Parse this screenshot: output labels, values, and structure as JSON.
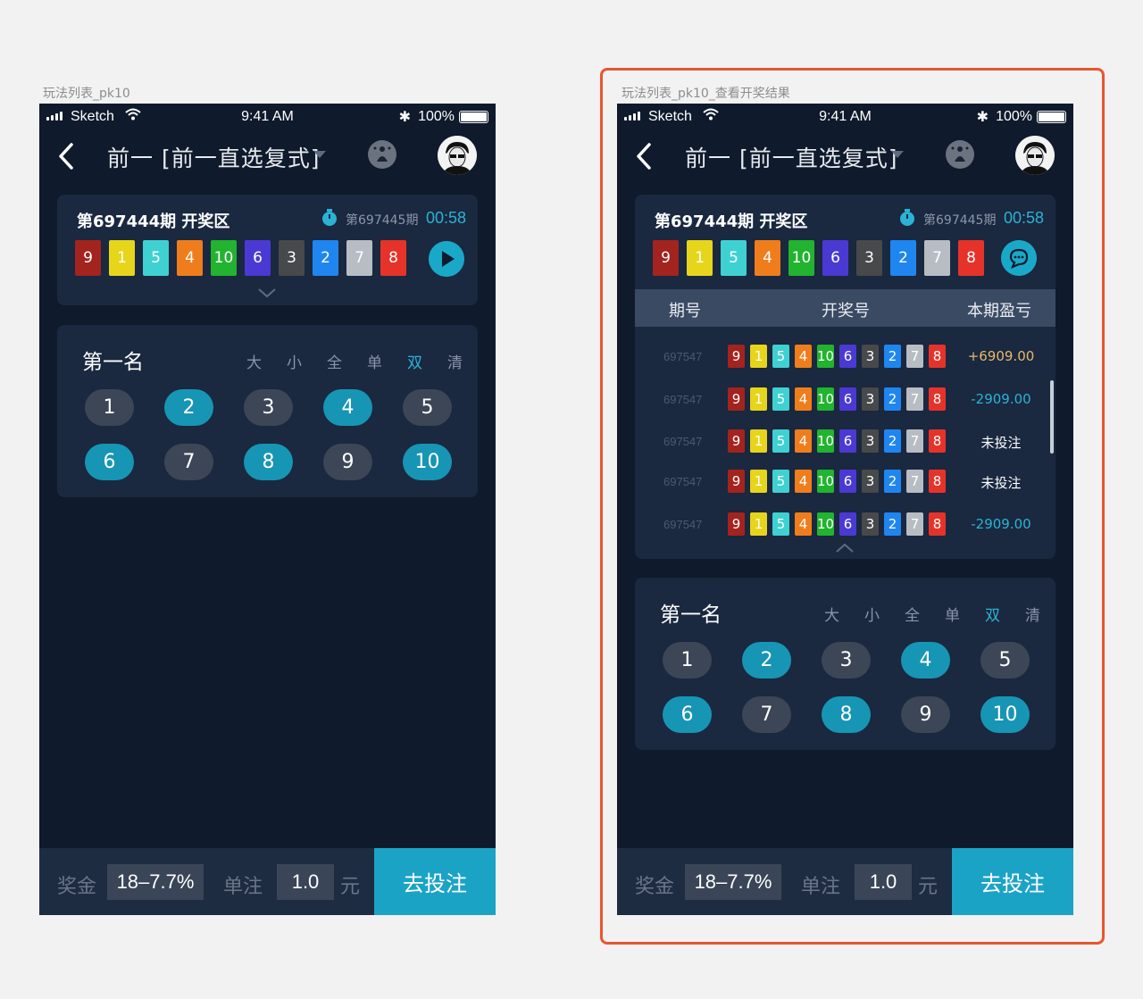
{
  "artboards": {
    "left_label": "玩法列表_pk10",
    "right_label": "玩法列表_pk10_查看开奖结果"
  },
  "status_bar": {
    "carrier": "Sketch",
    "time": "9:41 AM",
    "battery": "100%",
    "wifi_icon": "wifi-icon",
    "bluetooth_icon": "bluetooth-icon"
  },
  "nav": {
    "title": "前一 [前一直选复式]",
    "back_icon": "chevron-left-icon",
    "help_icon": "help-icon",
    "avatar_icon": "avatar"
  },
  "draw": {
    "title": "第697444期 开奖区",
    "next_period": "第697445期",
    "countdown": "00:58",
    "balls": [
      {
        "n": "9",
        "color": "#a3231e"
      },
      {
        "n": "1",
        "color": "#e7d51c"
      },
      {
        "n": "5",
        "color": "#3fd1d1"
      },
      {
        "n": "4",
        "color": "#f07d1c"
      },
      {
        "n": "10",
        "color": "#22b32f"
      },
      {
        "n": "6",
        "color": "#4b39d3"
      },
      {
        "n": "3",
        "color": "#48494b"
      },
      {
        "n": "2",
        "color": "#1f86f0"
      },
      {
        "n": "7",
        "color": "#b8bdc4"
      },
      {
        "n": "8",
        "color": "#e6332a"
      }
    ]
  },
  "history": {
    "headers": [
      "期号",
      "开奖号",
      "本期盈亏"
    ],
    "rows": [
      {
        "period": "697547",
        "result": "+6909.00",
        "color": "#e8b76b"
      },
      {
        "period": "697547",
        "result": "-2909.00",
        "color": "#2bb3d4"
      },
      {
        "period": "697547",
        "result": "未投注",
        "color": "#ffffff"
      },
      {
        "period": "697547",
        "result": "未投注",
        "color": "#ffffff"
      },
      {
        "period": "697547",
        "result": "-2909.00",
        "color": "#2bb3d4"
      }
    ]
  },
  "pick": {
    "title": "第一名",
    "filters": [
      {
        "label": "大",
        "active": false
      },
      {
        "label": "小",
        "active": false
      },
      {
        "label": "全",
        "active": false
      },
      {
        "label": "单",
        "active": false
      },
      {
        "label": "双",
        "active": true
      },
      {
        "label": "清",
        "active": false
      }
    ],
    "numbers": [
      {
        "n": "1",
        "selected": false
      },
      {
        "n": "2",
        "selected": true
      },
      {
        "n": "3",
        "selected": false
      },
      {
        "n": "4",
        "selected": true
      },
      {
        "n": "5",
        "selected": false
      },
      {
        "n": "6",
        "selected": true
      },
      {
        "n": "7",
        "selected": false
      },
      {
        "n": "8",
        "selected": true
      },
      {
        "n": "9",
        "selected": false
      },
      {
        "n": "10",
        "selected": true
      }
    ]
  },
  "bottom": {
    "prize_label": "奖金",
    "prize_value": "18–7.7%",
    "unit_label": "单注",
    "unit_value": "1.0",
    "currency": "元",
    "bet_button": "去投注"
  },
  "colors": {
    "accent": "#1ba3c6",
    "background": "#0f1a2c",
    "card": "#1a2840",
    "highlight": "#e8562f"
  }
}
